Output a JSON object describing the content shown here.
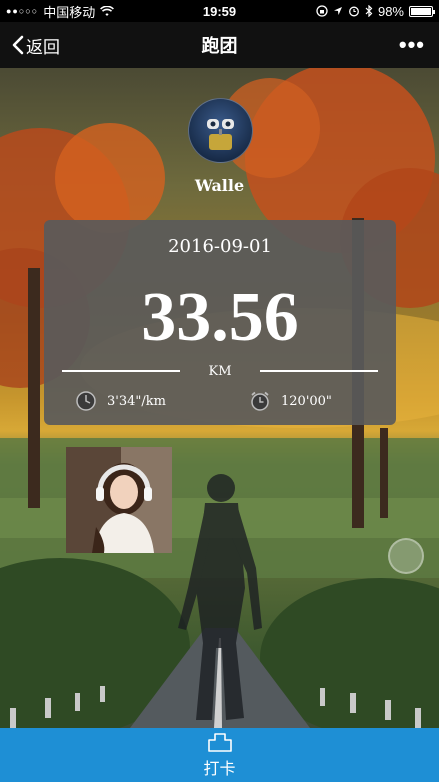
{
  "status_bar": {
    "carrier": "中国移动",
    "time": "19:59",
    "battery": "98%",
    "battery_level": 0.98,
    "icons": [
      "signal-dots-icon",
      "wifi-icon",
      "rotation-lock-icon",
      "location-icon",
      "alarm-icon",
      "bluetooth-icon",
      "battery-icon"
    ]
  },
  "nav": {
    "back_label": "返回",
    "title": "跑团",
    "more_label": "•••"
  },
  "profile": {
    "username": "Walle"
  },
  "run": {
    "date": "2016-09-01",
    "distance": "33.56",
    "unit": "KM",
    "pace": "3'34\"/km",
    "duration": "120'00\""
  },
  "action": {
    "label": "打卡"
  },
  "colors": {
    "nav_bg": "#111111",
    "action_bar": "#1e8fd5",
    "card_bg": "#5a5a5a"
  }
}
